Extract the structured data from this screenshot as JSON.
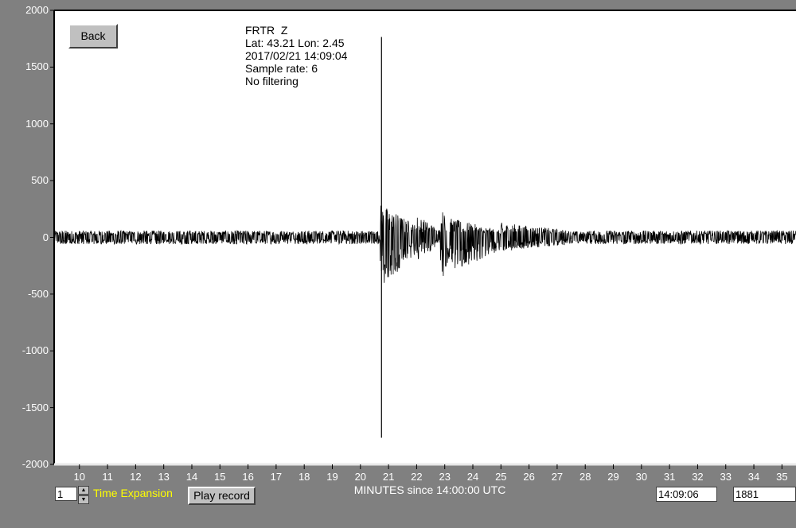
{
  "station": {
    "name": "FRTR  Z",
    "location": "Lat: 43.21 Lon: 2.45",
    "datetime": "2017/02/21 14:09:04",
    "sample_rate": "Sample rate: 6",
    "filter": "No filtering"
  },
  "controls": {
    "back_label": "Back",
    "expansion_value": "1",
    "expansion_label": "Time Expansion",
    "play_label": "Play record",
    "time_value": "14:09:06",
    "count_value": "1881"
  },
  "colors": {
    "background": "#808080",
    "plot": "#ffffff",
    "trace": "#000000",
    "axis_text": "#ffffff",
    "expansion_text": "#ffff00"
  },
  "chart_data": {
    "type": "line",
    "title": "",
    "xlabel": "MINUTES since 14:00:00 UTC",
    "ylabel": "",
    "xlim": [
      9.1,
      35.5
    ],
    "ylim": [
      -2000,
      2000
    ],
    "x_ticks": [
      10,
      11,
      12,
      13,
      14,
      15,
      16,
      17,
      18,
      19,
      20,
      21,
      22,
      23,
      24,
      25,
      26,
      27,
      28,
      29,
      30,
      31,
      32,
      33,
      34,
      35
    ],
    "x_tick_labels": [
      "10",
      "11",
      "12",
      "13",
      "14",
      "15",
      "16",
      "17",
      "18",
      "19",
      "20",
      "21",
      "22",
      "23",
      "24",
      "25",
      "26",
      "27",
      "28",
      "29",
      "30",
      "31",
      "32",
      "33",
      "34",
      "35"
    ],
    "y_ticks": [
      2000,
      1500,
      1000,
      500,
      0,
      -500,
      -1000,
      -1500,
      -2000
    ],
    "y_tick_labels": [
      "2000",
      "1500",
      "1000",
      "500",
      "0",
      "-500",
      "-1000",
      "-1500",
      "-2000"
    ],
    "grid": false,
    "legend": "none",
    "marker": {
      "x": 20.75,
      "y_range": [
        -1765,
        1765
      ]
    },
    "series": [
      {
        "noise_floor": 60,
        "events": [
          {
            "x_start": 20.7,
            "x_end": 22.0,
            "peak_pos": 300,
            "peak_neg": -450
          },
          {
            "x_start": 22.0,
            "x_end": 22.85,
            "peak_pos": 200,
            "peak_neg": -200
          },
          {
            "x_start": 22.85,
            "x_end": 23.2,
            "peak_pos": 280,
            "peak_neg": -430
          },
          {
            "x_start": 23.2,
            "x_end": 25.0,
            "peak_pos": 170,
            "peak_neg": -320
          },
          {
            "x_start": 25.0,
            "x_end": 28.0,
            "peak_pos": 130,
            "peak_neg": -130
          }
        ]
      }
    ]
  }
}
